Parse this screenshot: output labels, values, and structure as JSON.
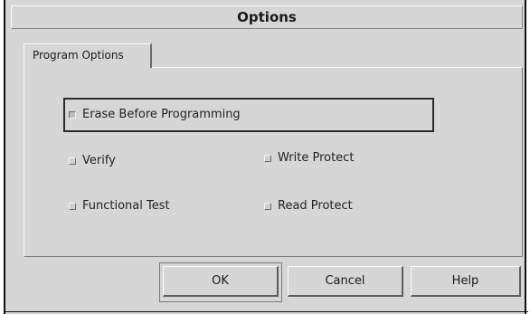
{
  "dialog": {
    "title": "Options"
  },
  "tabs": [
    {
      "label": "Program Options",
      "active": true
    }
  ],
  "options": {
    "erase": {
      "label": "Erase Before Programming",
      "checked": true
    },
    "verify": {
      "label": "Verify",
      "checked": false
    },
    "write_protect": {
      "label": "Write Protect",
      "checked": false
    },
    "functional_test": {
      "label": "Functional Test",
      "checked": false
    },
    "read_protect": {
      "label": "Read Protect",
      "checked": false
    }
  },
  "buttons": {
    "ok": "OK",
    "cancel": "Cancel",
    "help": "Help"
  }
}
